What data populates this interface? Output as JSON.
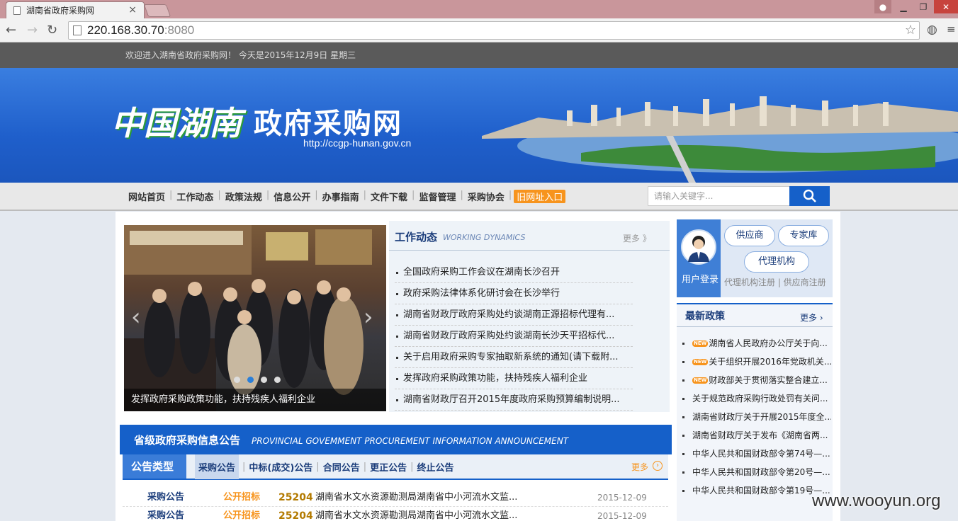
{
  "browser": {
    "tab_title": "湖南省政府采购网",
    "url_host": "220.168.30.70",
    "url_port": ":8080"
  },
  "topbar": {
    "welcome": "欢迎进入湖南省政府采购网！  今天是2015年12月9日  星期三"
  },
  "banner": {
    "logo_calligraphy": "中国湖南",
    "logo_title": "政府采购网",
    "site_url": "http://ccgp-hunan.gov.cn"
  },
  "nav": {
    "items": [
      "网站首页",
      "工作动态",
      "政策法规",
      "信息公开",
      "办事指南",
      "文件下载",
      "监督管理",
      "采购协会"
    ],
    "old_site": "旧网址入口",
    "search_placeholder": "请输入关键字..."
  },
  "slider": {
    "caption": "发挥政府采购政策功能，扶持残疾人福利企业",
    "active_dot": 2
  },
  "work_news": {
    "title": "工作动态",
    "title_en": "WORKING DYNAMICS",
    "more": "更多 》",
    "items": [
      "全国政府采购工作会议在湖南长沙召开",
      "政府采购法律体系化研讨会在长沙举行",
      "湖南省财政厅政府采购处约谈湖南正源招标代理有...",
      "湖南省财政厅政府采购处约谈湖南长沙天平招标代...",
      "关于启用政府采购专家抽取新系统的通知(请下载附...",
      "发挥政府采购政策功能，扶持残疾人福利企业",
      "湖南省财政厅召开2015年度政府采购预算编制说明..."
    ]
  },
  "provincial": {
    "title": "省级政府采购信息公告",
    "title_en": "PROVINCIAL GOVEMMENT PROCUREMENT INFORMATION ANNOUNCEMENT",
    "type_label": "公告类型",
    "tabs": [
      "采购公告",
      "中标(成交)公告",
      "合同公告",
      "更正公告",
      "终止公告"
    ],
    "more": "更多",
    "rows": [
      {
        "type": "采购公告",
        "method": "公开招标",
        "code": "25204",
        "title": "湖南省水文水资源勘测局湖南省中小河流水文监...",
        "date": "2015-12-09"
      },
      {
        "type": "采购公告",
        "method": "公开招标",
        "code": "25204",
        "title": "湖南省水文水资源勘测局湖南省中小河流水文监...",
        "date": "2015-12-09"
      }
    ]
  },
  "user_panel": {
    "login": "用户登录",
    "buttons": [
      "供应商",
      "专家库",
      "代理机构"
    ],
    "links": "代理机构注册   |   供应商注册"
  },
  "policy": {
    "title": "最新政策",
    "more": "更多 ›",
    "new_badge": "NEW",
    "items": [
      {
        "text": "湖南省人民政府办公厅关于向...",
        "new": true
      },
      {
        "text": "关于组织开展2016年党政机关...",
        "new": true
      },
      {
        "text": "财政部关于贯彻落实整合建立...",
        "new": true
      },
      {
        "text": "关于规范政府采购行政处罚有关问...",
        "new": false
      },
      {
        "text": "湖南省财政厅关于开展2015年度全...",
        "new": false
      },
      {
        "text": "湖南省财政厅关于发布《湖南省两...",
        "new": false
      },
      {
        "text": "中华人民共和国财政部令第74号—...",
        "new": false
      },
      {
        "text": "中华人民共和国财政部令第20号—...",
        "new": false
      },
      {
        "text": "中华人民共和国财政部令第19号—...",
        "new": false
      }
    ]
  },
  "watermark": "www.wooyun.org"
}
